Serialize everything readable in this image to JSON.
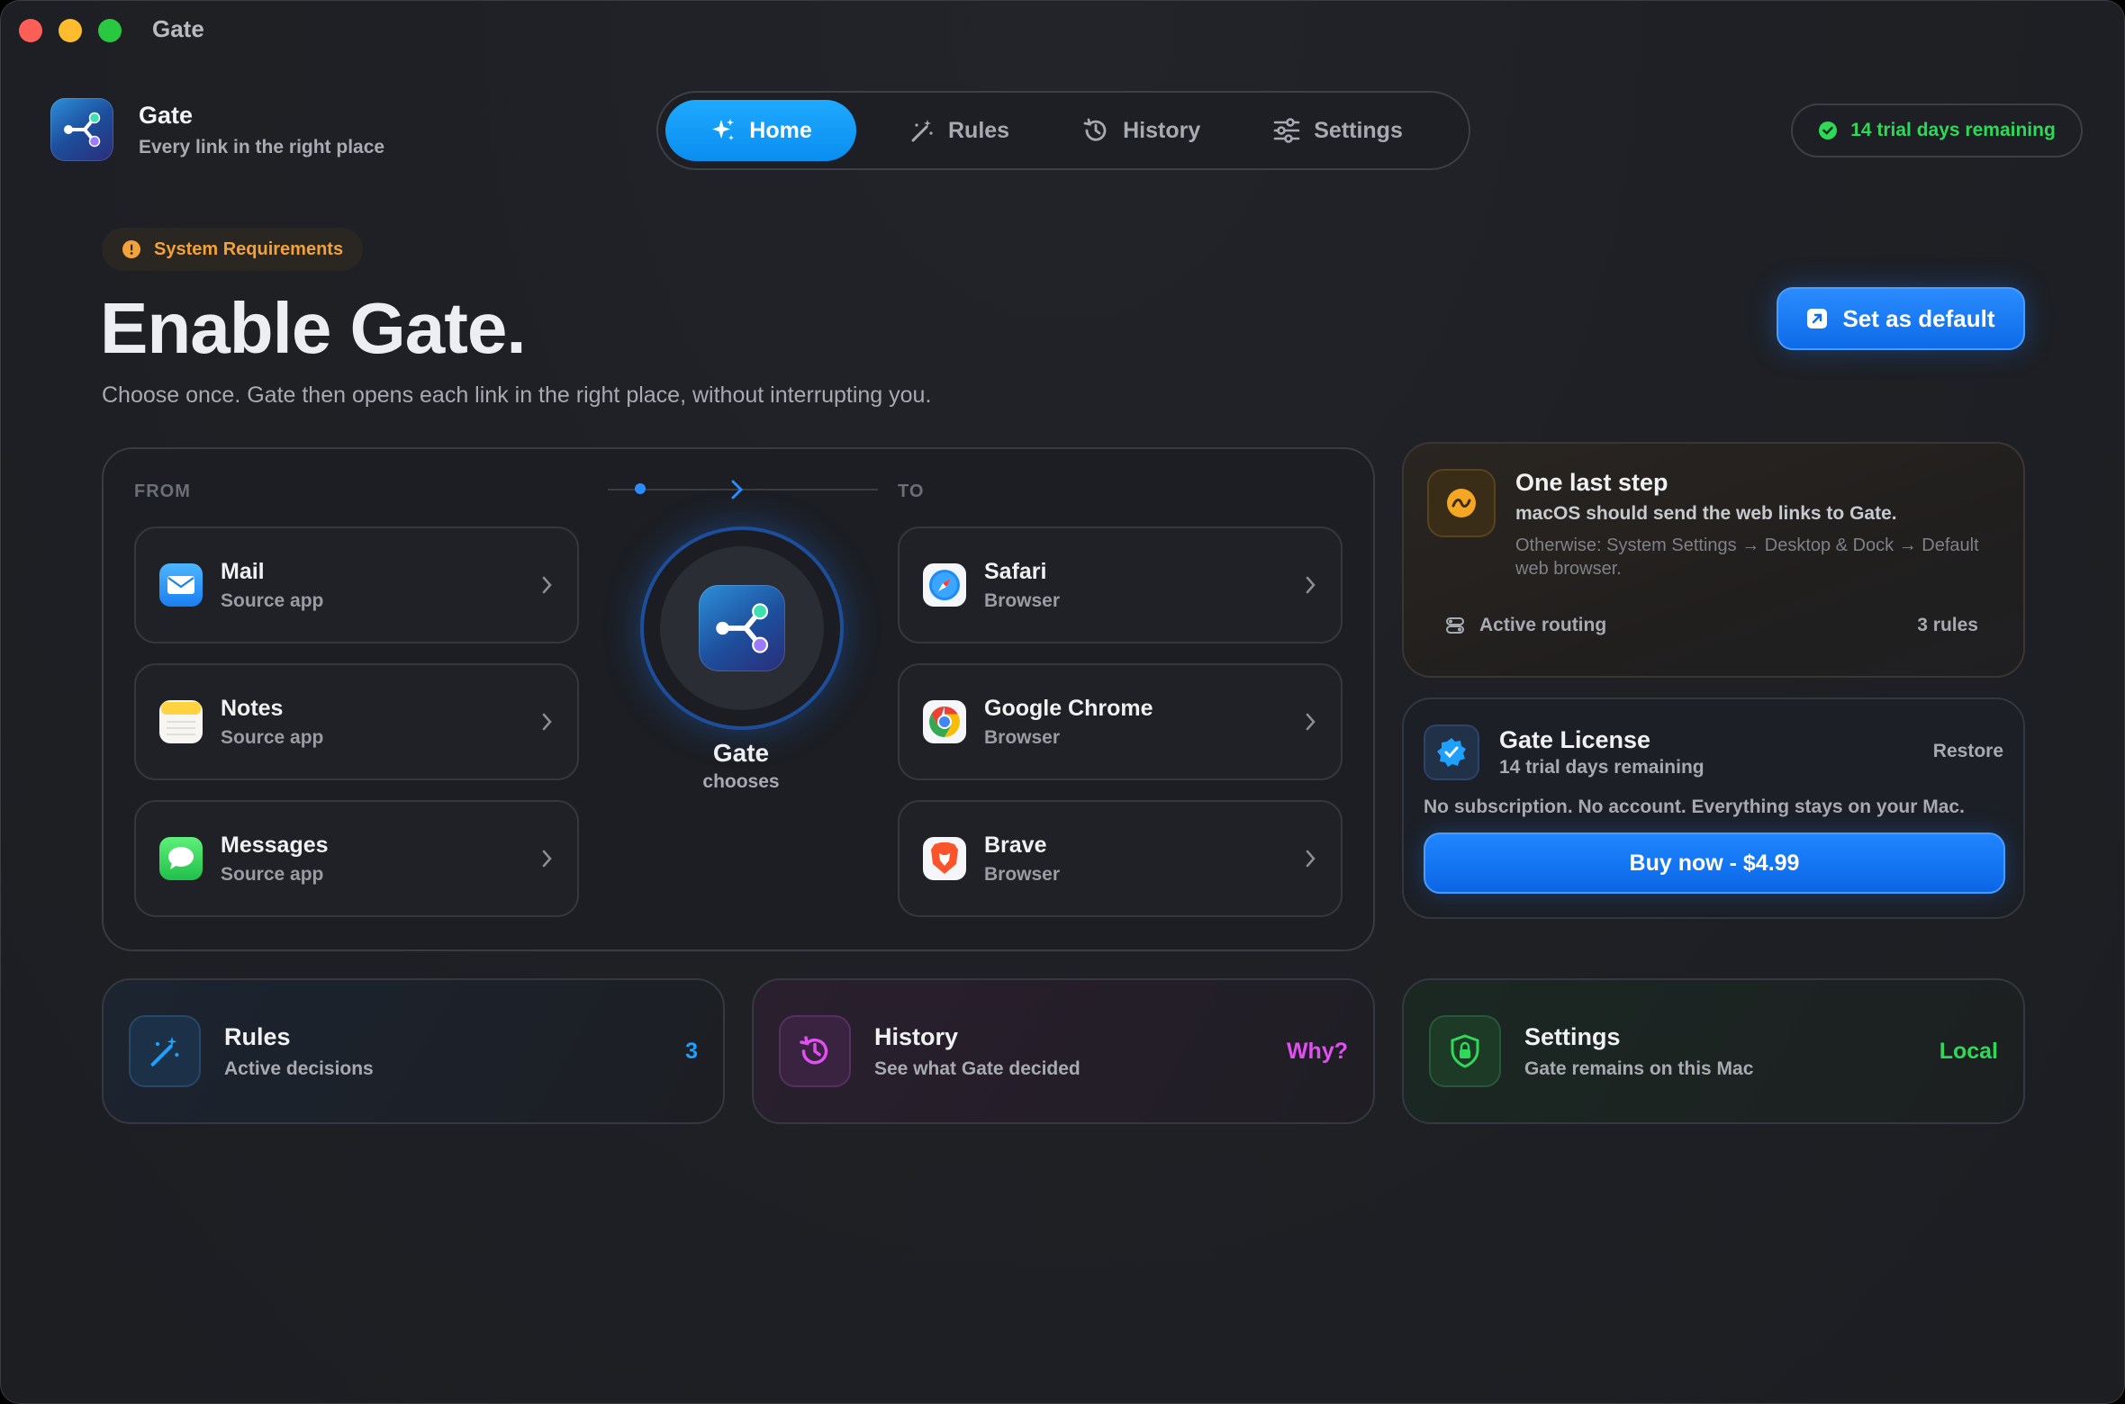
{
  "window": {
    "title": "Gate"
  },
  "brand": {
    "name": "Gate",
    "tagline": "Every link in the right place",
    "icon": "gate-share-icon"
  },
  "nav": {
    "tabs": [
      {
        "label": "Home",
        "icon": "sparkle-icon",
        "active": true
      },
      {
        "label": "Rules",
        "icon": "magic-wand-icon",
        "active": false
      },
      {
        "label": "History",
        "icon": "history-clock-icon",
        "active": false
      },
      {
        "label": "Settings",
        "icon": "sliders-icon",
        "active": false
      }
    ]
  },
  "trial_badge": {
    "label": "14 trial days remaining",
    "color": "#2fd858"
  },
  "hero": {
    "badge": "System Requirements",
    "title": "Enable Gate.",
    "subtitle": "Choose once. Gate then opens each link in the right place, without interrupting you.",
    "default_button": "Set as default"
  },
  "flow": {
    "from_label": "FROM",
    "to_label": "TO",
    "sources": [
      {
        "name": "Mail",
        "sub": "Source app",
        "icon": "mail-icon"
      },
      {
        "name": "Notes",
        "sub": "Source app",
        "icon": "notes-icon"
      },
      {
        "name": "Messages",
        "sub": "Source app",
        "icon": "messages-icon"
      }
    ],
    "targets": [
      {
        "name": "Safari",
        "sub": "Browser",
        "icon": "safari-icon"
      },
      {
        "name": "Google Chrome",
        "sub": "Browser",
        "icon": "chrome-icon"
      },
      {
        "name": "Brave",
        "sub": "Browser",
        "icon": "brave-icon"
      }
    ],
    "hub": {
      "name": "Gate",
      "sub": "chooses"
    }
  },
  "step_card": {
    "title": "One last step",
    "desc": "macOS should send the web links to Gate.",
    "hint": "Otherwise: System Settings → Desktop & Dock → Default web browser.",
    "routing_label": "Active routing",
    "rules_count": "3 rules"
  },
  "license_card": {
    "title": "Gate License",
    "sub": "14 trial days remaining",
    "restore": "Restore",
    "note": "No subscription. No account. Everything stays on your Mac.",
    "buy_button": "Buy now - $4.99"
  },
  "bottom_cards": [
    {
      "title": "Rules",
      "sub": "Active decisions",
      "value": "3",
      "value_color": "#1ea0ff",
      "icon": "magic-wand-icon"
    },
    {
      "title": "History",
      "sub": "See what Gate decided",
      "value": "Why?",
      "value_color": "#e050f0",
      "icon": "history-clock-icon"
    },
    {
      "title": "Settings",
      "sub": "Gate remains on this Mac",
      "value": "Local",
      "value_color": "#2fd858",
      "icon": "shield-lock-icon"
    }
  ]
}
